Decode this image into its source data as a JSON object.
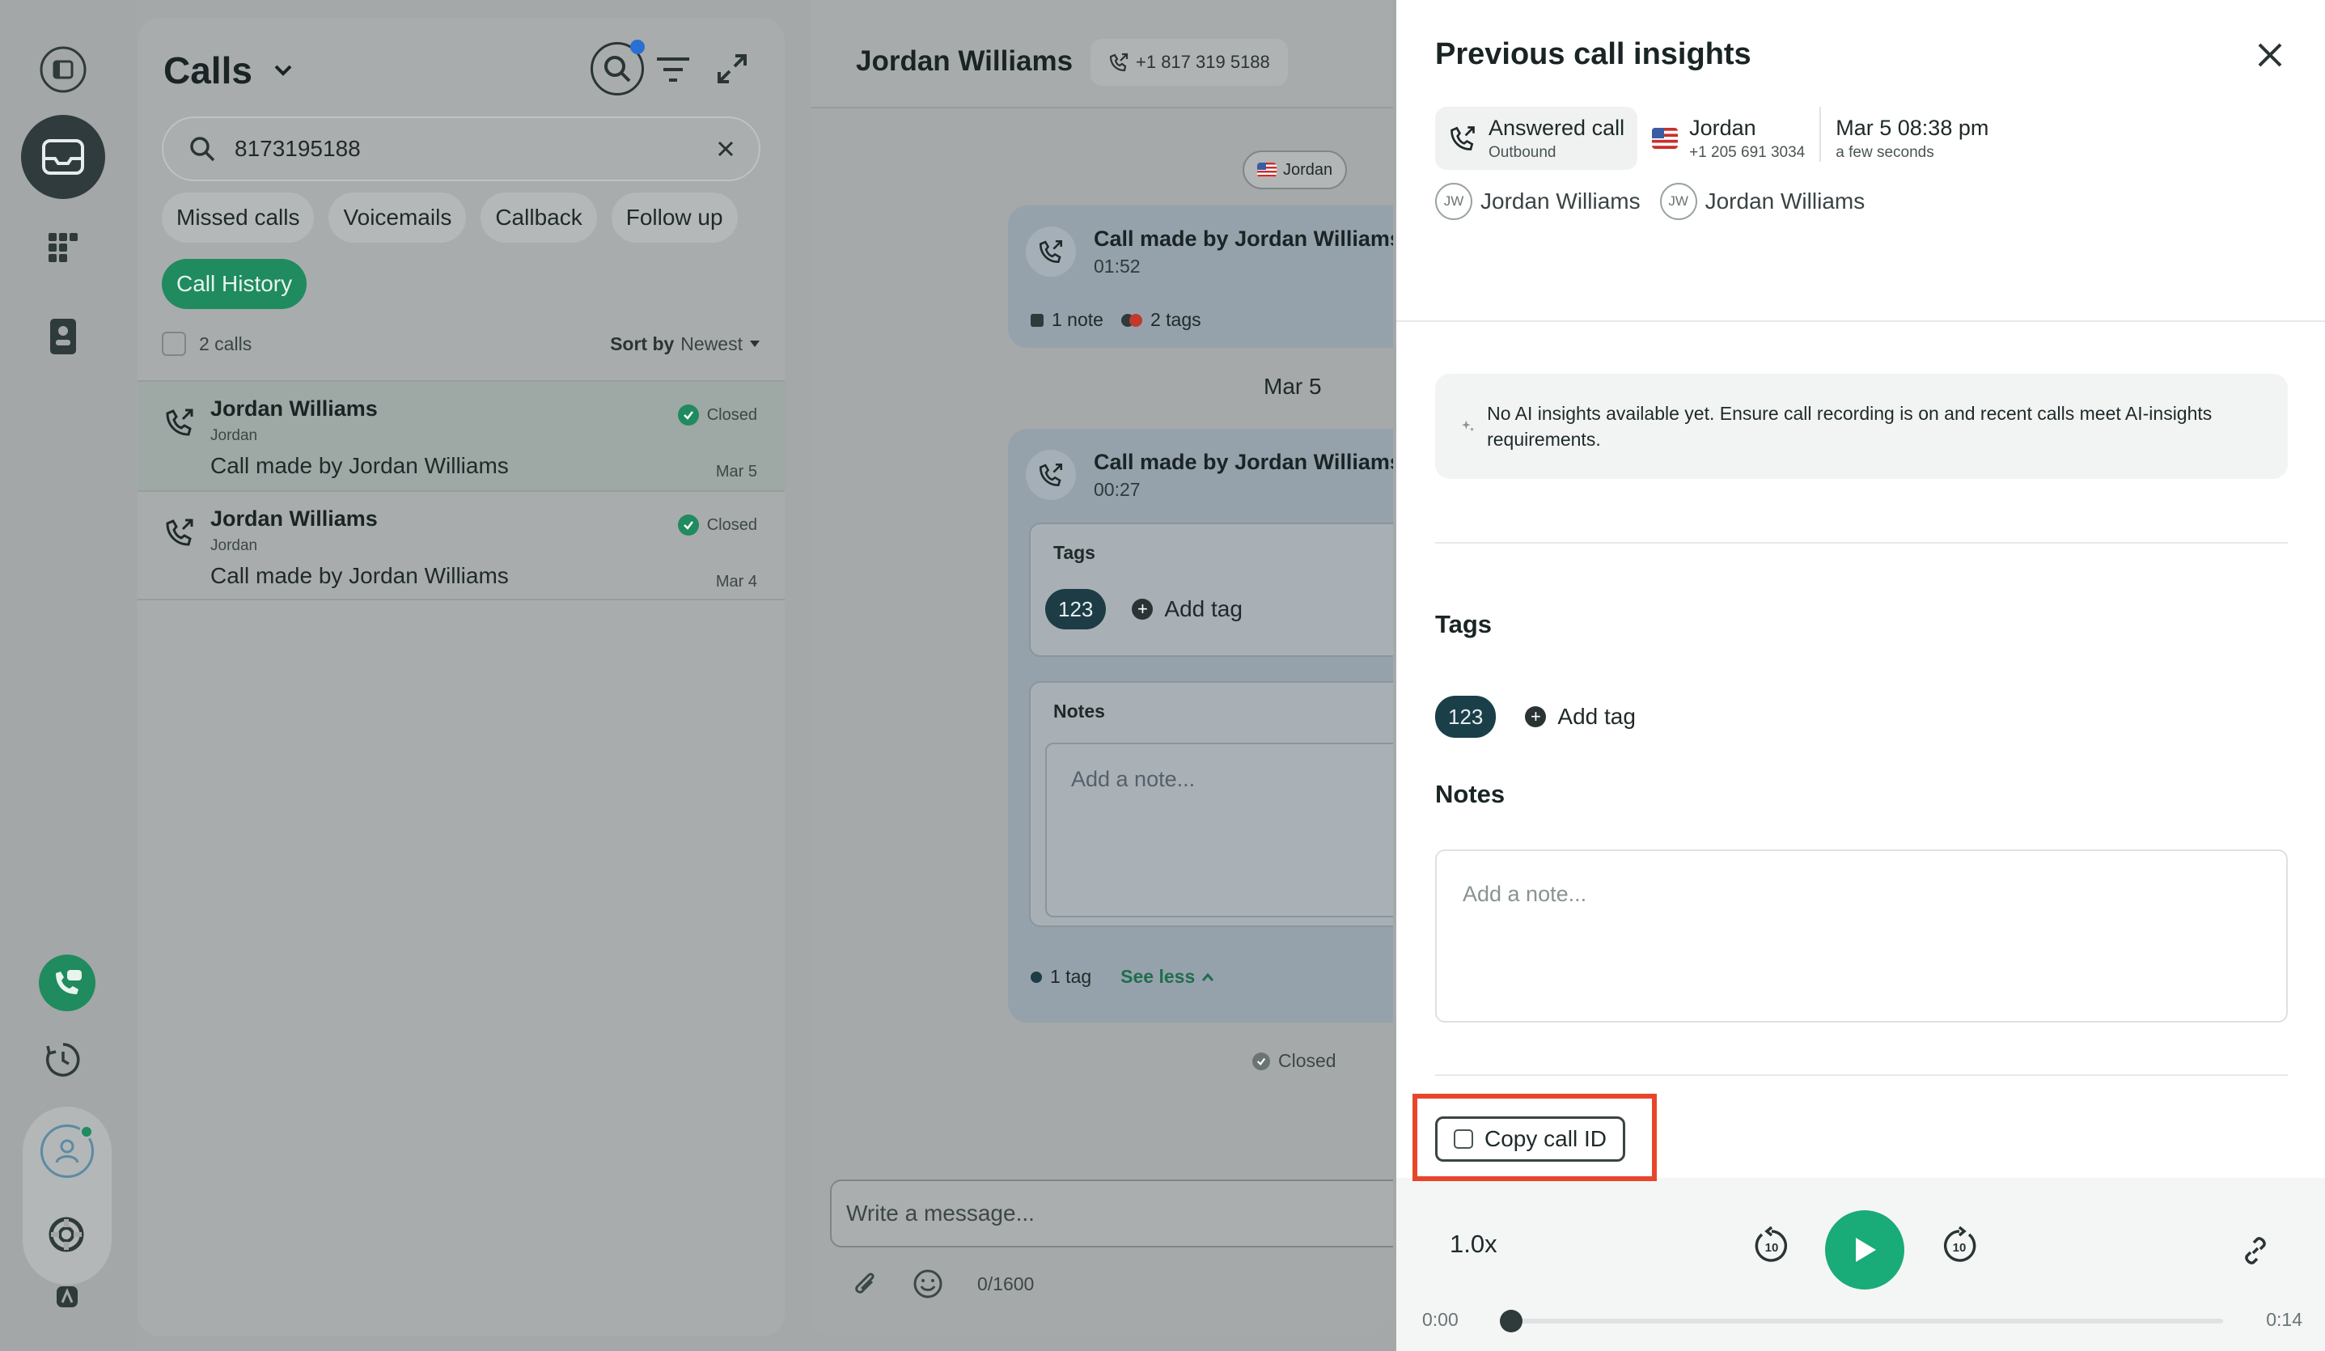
{
  "calls_panel": {
    "title": "Calls",
    "search_value": "8173195188",
    "chips": [
      "Missed calls",
      "Voicemails",
      "Callback",
      "Follow up"
    ],
    "active_chip": "Call History",
    "count": "2 calls",
    "sort_label": "Sort by",
    "sort_value": "Newest",
    "rows": [
      {
        "name": "Jordan Williams",
        "sub": "Jordan",
        "desc": "Call made by Jordan Williams",
        "status": "Closed",
        "date": "Mar 5"
      },
      {
        "name": "Jordan Williams",
        "sub": "Jordan",
        "desc": "Call made by Jordan Williams",
        "status": "Closed",
        "date": "Mar 4"
      }
    ]
  },
  "conversation": {
    "name": "Jordan Williams",
    "phone": "+1 817 319 5188",
    "line_pill": "Jordan",
    "card1": {
      "title": "Call made by Jordan Williams",
      "time": "01:52",
      "notes": "1 note",
      "tags": "2 tags"
    },
    "date_sep": "Mar 5",
    "card2": {
      "title": "Call made by Jordan Williams",
      "time": "00:27",
      "tags_label": "Tags",
      "tag": "123",
      "add_tag": "Add tag",
      "notes_label": "Notes",
      "note_placeholder": "Add a note...",
      "tag_count": "1 tag",
      "see_less": "See less"
    },
    "closed": "Closed",
    "message_placeholder": "Write a message...",
    "char_count": "0/1600"
  },
  "insights": {
    "title": "Previous call insights",
    "call_status": "Answered call",
    "direction": "Outbound",
    "line_name": "Jordan",
    "line_number": "+1 205 691 3034",
    "date": "Mar 5 08:38 pm",
    "relative": "a few seconds",
    "people": [
      {
        "initials": "JW",
        "name": "Jordan Williams"
      },
      {
        "initials": "JW",
        "name": "Jordan Williams"
      }
    ],
    "ai_message": "No AI insights available yet. Ensure call recording is on and recent calls meet AI-insights requirements.",
    "tags_label": "Tags",
    "tag": "123",
    "add_tag": "Add tag",
    "notes_label": "Notes",
    "note_placeholder": "Add a note...",
    "copy_label": "Copy call ID",
    "player": {
      "speed": "1.0x",
      "skip_back": "10",
      "skip_forward": "10",
      "start": "0:00",
      "end": "0:14",
      "progress": 0
    }
  },
  "colors": {
    "accent": "#19ab78",
    "highlight": "#e8462b",
    "tag": "#1b3f49"
  }
}
